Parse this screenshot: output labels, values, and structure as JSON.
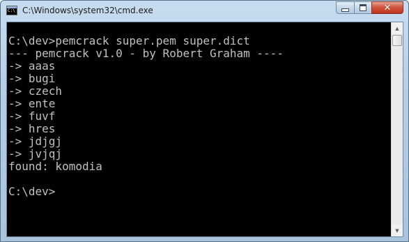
{
  "window": {
    "title": "C:\\Windows\\system32\\cmd.exe"
  },
  "icons": {
    "app": "cmd-console-icon",
    "minimize": "minimize-icon",
    "maximize": "maximize-icon",
    "close": "close-icon",
    "scroll_up": "scroll-up-arrow-icon",
    "scroll_down": "scroll-down-arrow-icon"
  },
  "colors": {
    "console_background": "#000000",
    "console_text": "#c0c0c0",
    "close_button": "#c7402b"
  },
  "console": {
    "lines": [
      "",
      "C:\\dev>pemcrack super.pem super.dict",
      "--- pemcrack v1.0 - by Robert Graham ----",
      "-> aaas",
      "-> bugi",
      "-> czech",
      "-> ente",
      "-> fuvf",
      "-> hres",
      "-> jdjgj",
      "-> jvjqj",
      "found: komodia",
      "",
      "C:\\dev>"
    ]
  },
  "scrollbar": {
    "up_arrow": "▲",
    "down_arrow": "▼"
  },
  "caption": {
    "close_glyph": "✕"
  }
}
